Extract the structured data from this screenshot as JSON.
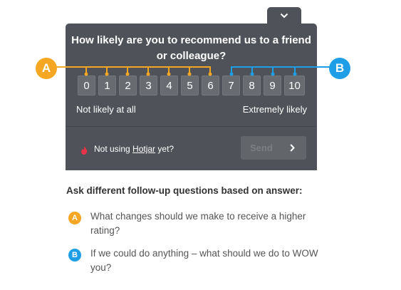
{
  "widget": {
    "question": "How likely are you to recommend us to a friend or colleague?",
    "scale": [
      "0",
      "1",
      "2",
      "3",
      "4",
      "5",
      "6",
      "7",
      "8",
      "9",
      "10"
    ],
    "low_label": "Not likely at all",
    "high_label": "Extremely likely",
    "footer": {
      "not_using_text": "Not using",
      "hotjar_link": "Hotjar",
      "yet_text": "yet?",
      "send_label": "Send"
    },
    "colors": {
      "panel": "#4f5258",
      "button": "#686b70",
      "accent_a": "#f5a623",
      "accent_b": "#1f9ee8"
    }
  },
  "annotations": {
    "heading": "Ask different follow-up questions based on answer:",
    "items": [
      {
        "badge": "A",
        "text": "What changes should we make to receive a higher rating?"
      },
      {
        "badge": "B",
        "text": "If we could do anything – what should we do to WOW you?"
      }
    ]
  }
}
